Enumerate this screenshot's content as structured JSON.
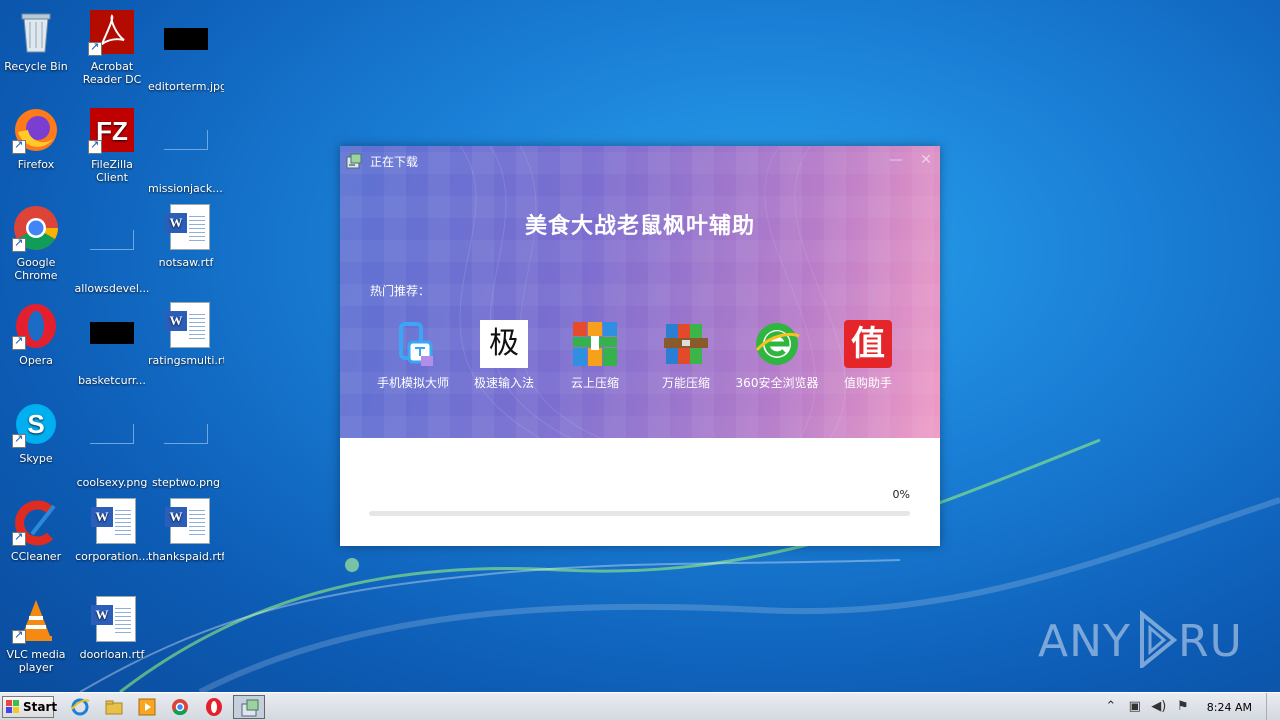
{
  "desktop": {
    "icons": [
      {
        "label": "Recycle Bin"
      },
      {
        "label": "Acrobat Reader DC"
      },
      {
        "label": "editorterm.jpg"
      },
      {
        "label": "Firefox"
      },
      {
        "label": "FileZilla Client"
      },
      {
        "label": "missionjack...."
      },
      {
        "label": "Google Chrome"
      },
      {
        "label": "allowsdevel..."
      },
      {
        "label": "notsaw.rtf"
      },
      {
        "label": "Opera"
      },
      {
        "label": "basketcurr..."
      },
      {
        "label": "ratingsmulti.rtf"
      },
      {
        "label": "Skype"
      },
      {
        "label": "coolsexy.png"
      },
      {
        "label": "steptwo.png"
      },
      {
        "label": "CCleaner"
      },
      {
        "label": "corporation..."
      },
      {
        "label": "thankspaid.rtf"
      },
      {
        "label": "VLC media player"
      },
      {
        "label": "doorloan.rtf"
      }
    ]
  },
  "dialog": {
    "title": "正在下载",
    "minimize_icon": "minimize-icon",
    "close_icon": "close-icon",
    "heading": "美食大战老鼠枫叶辅助",
    "section_label": "热门推荐：",
    "apps": [
      {
        "label": "手机模拟大师",
        "icon": "phone-emulator-icon"
      },
      {
        "label": "极速输入法",
        "icon": "input-method-icon",
        "glyph": "极"
      },
      {
        "label": "云上压缩",
        "icon": "cloud-compress-icon"
      },
      {
        "label": "万能压缩",
        "icon": "archive-icon"
      },
      {
        "label": "360安全浏览器",
        "icon": "browser-360-icon"
      },
      {
        "label": "值购助手",
        "icon": "shopping-assistant-icon",
        "glyph": "值"
      }
    ],
    "progress_text": "0%",
    "progress_value": 0,
    "accent_color": "#7c6ed0"
  },
  "watermark": "ANY RUN",
  "taskbar": {
    "start_label": "Start",
    "clock": "8:24 AM"
  }
}
